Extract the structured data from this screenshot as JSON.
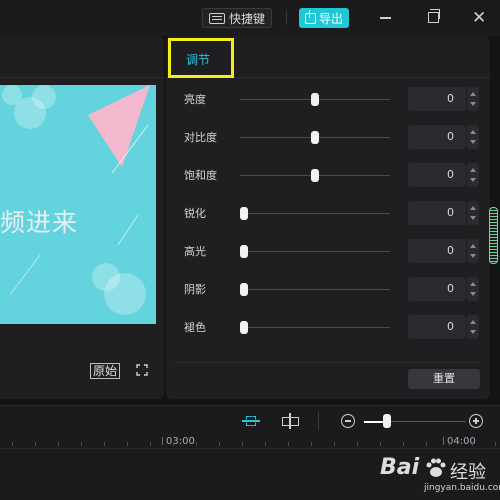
{
  "titlebar": {
    "shortcut_label": "快捷键",
    "export_label": "导出",
    "close_glyph": "✕"
  },
  "player": {
    "canvas_text": "频进来",
    "original_label": "原始",
    "colors": {
      "canvas_bg": "#63d3dd",
      "triangle": "#f4b8cf"
    }
  },
  "adjust": {
    "tab_label": "调节",
    "params": [
      {
        "label": "亮度",
        "value": "0",
        "level": 0.5
      },
      {
        "label": "对比度",
        "value": "0",
        "level": 0.5
      },
      {
        "label": "饱和度",
        "value": "0",
        "level": 0.5
      },
      {
        "label": "锐化",
        "value": "0",
        "level": 0.0
      },
      {
        "label": "高光",
        "value": "0",
        "level": 0.0
      },
      {
        "label": "阴影",
        "value": "0",
        "level": 0.0
      },
      {
        "label": "褪色",
        "value": "0",
        "level": 0.0
      }
    ],
    "reset_label": "重置"
  },
  "timeline": {
    "zoom_level": 0.2,
    "ruler": [
      {
        "label": "03:00"
      },
      {
        "label": "04:00"
      }
    ]
  },
  "watermark": {
    "logo": "Bai",
    "cn": "经验",
    "url": "jingyan.baidu.com"
  },
  "colors": {
    "accent": "#1fc8d4",
    "highlight_box": "#f5ee1a",
    "background": "#141416",
    "panel": "#1f1f22"
  }
}
